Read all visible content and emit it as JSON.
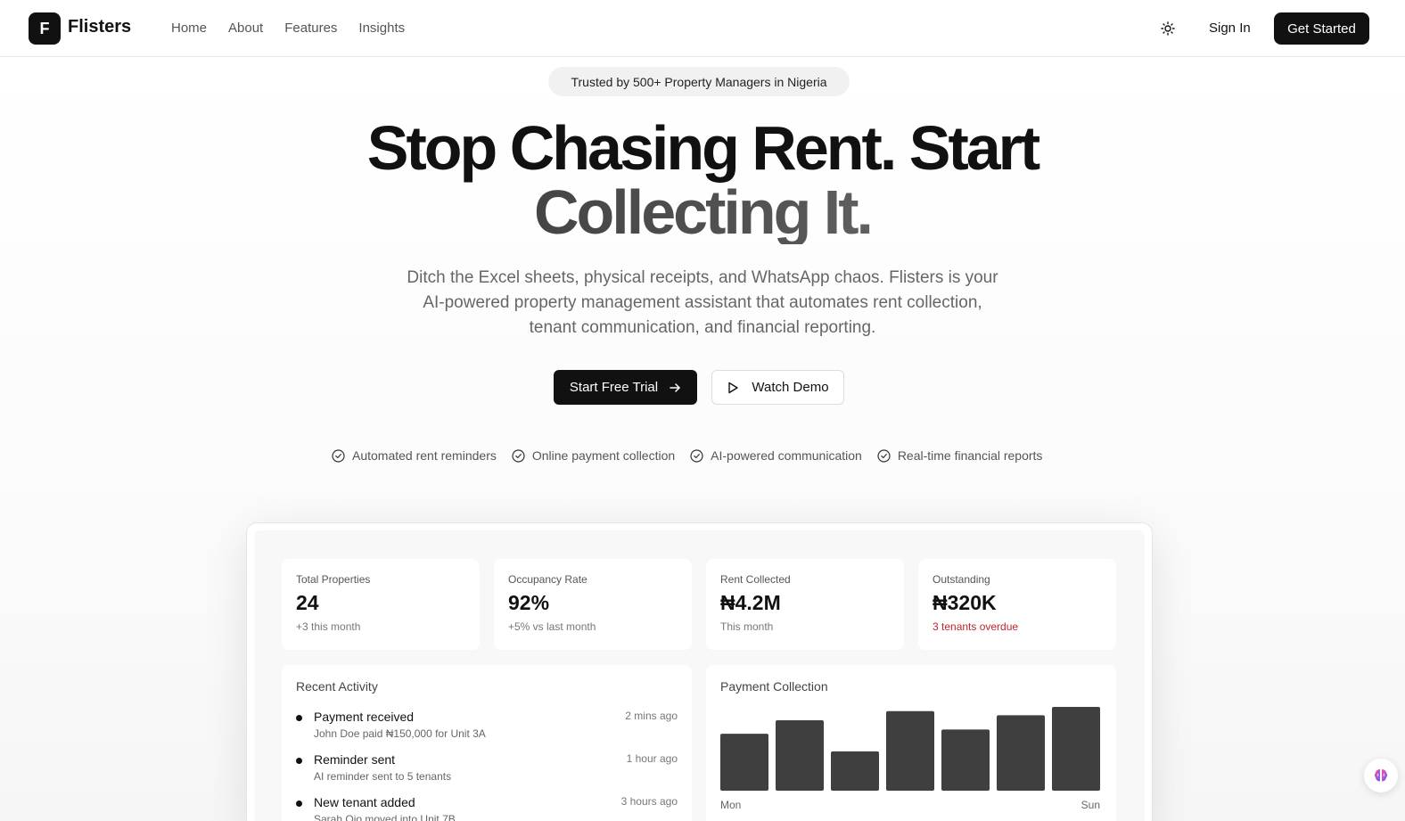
{
  "nav": {
    "logo_letter": "F",
    "brand": "Flisters",
    "links": [
      "Home",
      "About",
      "Features",
      "Insights"
    ],
    "theme_icon": "sun-icon",
    "signin": "Sign In",
    "get_started": "Get Started"
  },
  "hero": {
    "badge": "Trusted by 500+ Property Managers in Nigeria",
    "headline_line1": "Stop Chasing Rent. Start",
    "headline_line2": "Collecting It.",
    "subtext": "Ditch the Excel sheets, physical receipts, and WhatsApp chaos. Flisters is your AI-powered property management assistant that automates rent collection, tenant communication, and financial reporting.",
    "cta_primary": "Start Free Trial",
    "cta_secondary": "Watch Demo",
    "features": [
      "Automated rent reminders",
      "Online payment collection",
      "AI-powered communication",
      "Real-time financial reports"
    ]
  },
  "dashboard": {
    "stats": [
      {
        "label": "Total Properties",
        "value": "24",
        "sub": "+3 this month"
      },
      {
        "label": "Occupancy Rate",
        "value": "92%",
        "sub": "+5% vs last month"
      },
      {
        "label": "Rent Collected",
        "value": "₦4.2M",
        "sub": "This month"
      },
      {
        "label": "Outstanding",
        "value": "₦320K",
        "sub": "3 tenants overdue"
      }
    ],
    "activity": {
      "title": "Recent Activity",
      "items": [
        {
          "title": "Payment received",
          "desc": "John Doe paid ₦150,000 for Unit 3A",
          "time": "2 mins ago"
        },
        {
          "title": "Reminder sent",
          "desc": "AI reminder sent to 5 tenants",
          "time": "1 hour ago"
        },
        {
          "title": "New tenant added",
          "desc": "Sarah Ojo moved into Unit 7B",
          "time": "3 hours ago"
        }
      ]
    },
    "payment_collection": {
      "title": "Payment Collection",
      "x_start_label": "Mon",
      "x_end_label": "Sun"
    }
  },
  "chart_data": {
    "type": "bar",
    "title": "Payment Collection",
    "categories": [
      "Mon",
      "",
      "",
      "",
      "",
      "",
      "Sun"
    ],
    "values": [
      68,
      84,
      47,
      95,
      73,
      90,
      100
    ],
    "ylim": [
      0,
      100
    ],
    "grid": false,
    "bar_color": "#3f3f3f"
  },
  "colors": {
    "primary": "#111111",
    "alert": "#c0262d"
  },
  "floating": {
    "icon": "brain-icon"
  }
}
